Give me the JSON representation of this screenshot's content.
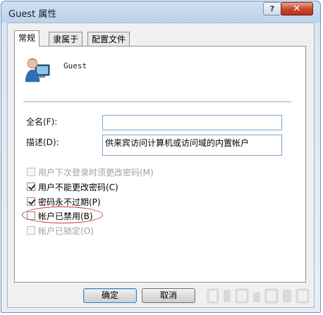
{
  "window": {
    "title": "Guest 属性",
    "help_label": "?",
    "close_label": "✕"
  },
  "tabs": [
    {
      "label": "常规",
      "active": true
    },
    {
      "label": "隶属于",
      "active": false
    },
    {
      "label": "配置文件",
      "active": false
    }
  ],
  "user": {
    "name": "Guest",
    "icon": "user-account-icon"
  },
  "fields": {
    "fullname_label": "全名(F):",
    "fullname_value": "",
    "description_label": "描述(D):",
    "description_value": "供来宾访问计算机或访问域的内置帐户"
  },
  "checkboxes": [
    {
      "label": "用户下次登录时须更改密码(M)",
      "checked": false,
      "enabled": false
    },
    {
      "label": "用户不能更改密码(C)",
      "checked": true,
      "enabled": true
    },
    {
      "label": "密码永不过期(P)",
      "checked": true,
      "enabled": true
    },
    {
      "label": "帐户已禁用(B)",
      "checked": false,
      "enabled": true
    },
    {
      "label": "帐户已锁定(O)",
      "checked": false,
      "enabled": false
    }
  ],
  "buttons": {
    "ok": "确定",
    "cancel": "取消"
  },
  "colors": {
    "highlight_ellipse": "#cf3b3b",
    "close_button": "#c94a2e"
  }
}
